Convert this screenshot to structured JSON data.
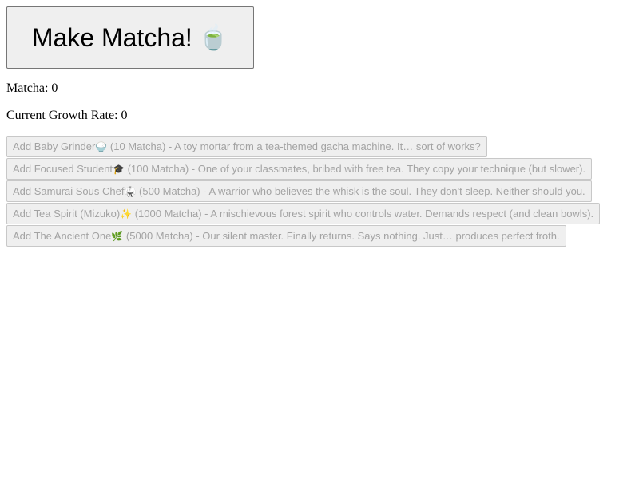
{
  "make_button": {
    "label": "Make Matcha!",
    "icon": "🍵",
    "icon_name": "tea-cup-icon"
  },
  "stats": {
    "matcha_label": "Matcha: ",
    "matcha_value": "0",
    "growth_label": "Current Growth Rate: ",
    "growth_value": "0"
  },
  "upgrades": [
    {
      "prefix": "Add Baby Grinder",
      "icon": "🍚",
      "icon_name": "rice-bowl-icon",
      "suffix": " (10 Matcha) - A toy mortar from a tea-themed gacha machine. It… sort of works?",
      "enabled": false
    },
    {
      "prefix": "Add Focused Student",
      "icon": "🎓",
      "icon_name": "graduation-cap-icon",
      "suffix": " (100 Matcha) - One of your classmates, bribed with free tea. They copy your technique (but slower).",
      "enabled": false
    },
    {
      "prefix": "Add Samurai Sous Chef",
      "icon": "🥋",
      "icon_name": "samurai-icon",
      "suffix": " (500 Matcha) - A warrior who believes the whisk is the soul. They don't sleep. Neither should you.",
      "enabled": false
    },
    {
      "prefix": "Add Tea Spirit (Mizuko)",
      "icon": "✨",
      "icon_name": "sparkles-icon",
      "suffix": " (1000 Matcha) - A mischievous forest spirit who controls water. Demands respect (and clean bowls).",
      "enabled": false
    },
    {
      "prefix": "Add The Ancient One",
      "icon": "🌿",
      "icon_name": "herb-icon",
      "suffix": " (5000 Matcha) - Our silent master. Finally returns. Says nothing. Just… produces perfect froth.",
      "enabled": false
    }
  ]
}
